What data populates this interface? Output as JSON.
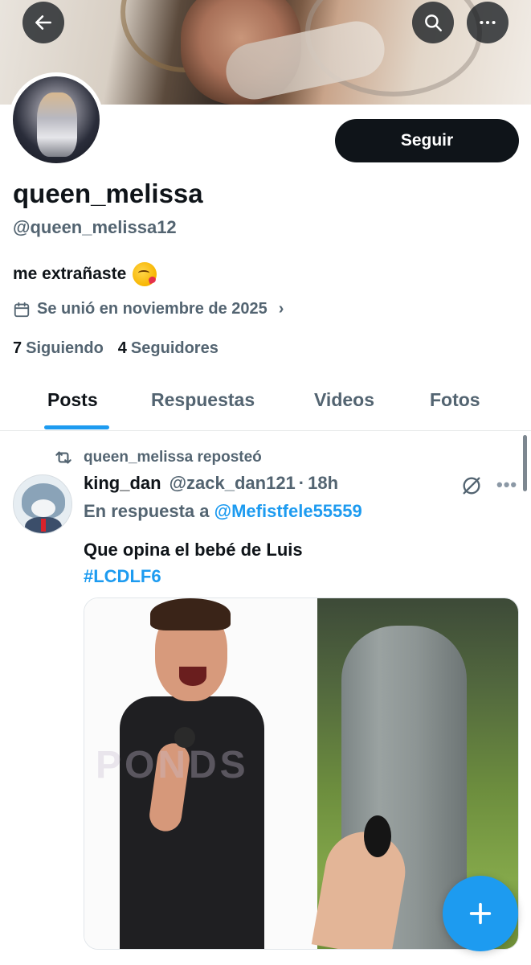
{
  "profile": {
    "display_name": "queen_melissa",
    "handle": "@queen_melissa12",
    "bio": "me extrañaste",
    "bio_emoji": "kissing-face-emoji",
    "joined": "Se unió en noviembre de 2025",
    "following_count": "7",
    "following_label": "Siguiendo",
    "followers_count": "4",
    "followers_label": "Seguidores"
  },
  "header": {
    "follow_label": "Seguir",
    "back_icon": "back-arrow-icon",
    "search_icon": "search-icon",
    "more_icon": "more-icon"
  },
  "tabs": [
    {
      "label": "Posts",
      "active": true
    },
    {
      "label": "Respuestas",
      "active": false
    },
    {
      "label": "Videos",
      "active": false
    },
    {
      "label": "Fotos",
      "active": false
    }
  ],
  "post": {
    "repost_label": "queen_melissa reposteó",
    "author_name": "king_dan",
    "author_handle": "@zack_dan121",
    "separator": "·",
    "time": "18h",
    "reply_prefix": "En respuesta a",
    "reply_mention": "@Mefistfele55559",
    "text": "Que opina el bebé de Luis",
    "hashtag": "#LCDLF6",
    "media_watermark": "PONDS"
  },
  "colors": {
    "accent": "#1d9bf0",
    "text_primary": "#0f1419",
    "text_secondary": "#536471",
    "button_dark": "#0f1419"
  }
}
